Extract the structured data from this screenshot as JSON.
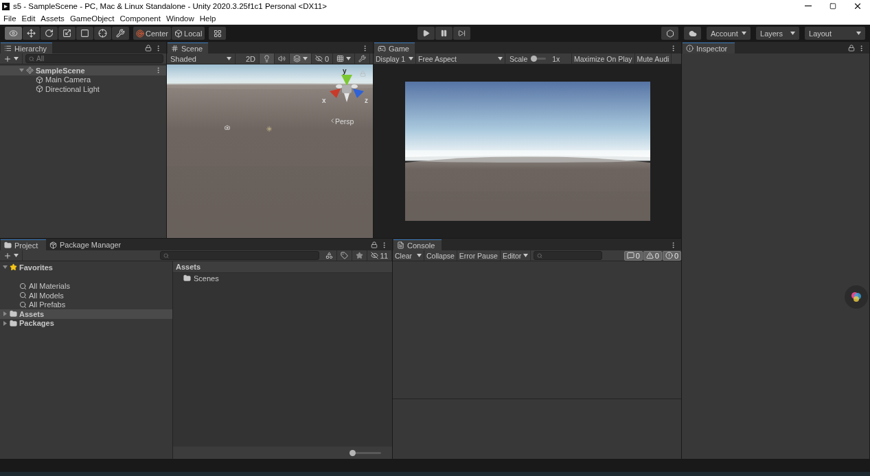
{
  "window": {
    "title": "s5 - SampleScene - PC, Mac & Linux Standalone - Unity 2020.3.25f1c1 Personal <DX11>"
  },
  "menu": [
    "File",
    "Edit",
    "Assets",
    "GameObject",
    "Component",
    "Window",
    "Help"
  ],
  "toolbar": {
    "tools": [
      {
        "selected": true
      },
      {
        "selected": false
      },
      {
        "selected": false
      },
      {
        "selected": false
      },
      {
        "selected": false
      },
      {
        "selected": false
      },
      {
        "selected": false
      }
    ],
    "pivot": [
      "Center",
      "Local"
    ],
    "dropdowns": [
      "Account",
      "Layers",
      "Layout"
    ]
  },
  "hierarchy": {
    "tab": "Hierarchy",
    "search_placeholder": "All",
    "tree": [
      {
        "label": "SampleScene",
        "kind": "scene",
        "expanded": true,
        "selected": true,
        "children": [
          {
            "label": "Main Camera",
            "kind": "object",
            "selected": false
          },
          {
            "label": "Directional Light",
            "kind": "object",
            "selected": false
          }
        ]
      }
    ]
  },
  "scene": {
    "tab": "Scene",
    "draw_mode": "Shaded",
    "mode_2d": "2D",
    "hidden_count": "0",
    "gizmo_labels": [
      "y",
      "x",
      "z"
    ],
    "projection": "Persp"
  },
  "game": {
    "tab": "Game",
    "display": "Display 1",
    "aspect": "Free Aspect",
    "scale_label": "Scale",
    "scale": {
      "level": 0
    },
    "scale_value": "1x",
    "buttons": [
      "Maximize On Play",
      "Mute Audi"
    ]
  },
  "inspector": {
    "tab": "Inspector"
  },
  "project": {
    "tabs": [
      {
        "label": "Project",
        "selected": true
      },
      {
        "label": "Package Manager",
        "selected": false
      }
    ],
    "hidden_count": "11",
    "tree": [
      {
        "label": "Favorites",
        "kind": "favorites",
        "expanded": true,
        "selected": false,
        "children": [
          {
            "label": "All Materials",
            "kind": "search",
            "selected": false
          },
          {
            "label": "All Models",
            "kind": "search",
            "selected": false
          },
          {
            "label": "All Prefabs",
            "kind": "search",
            "selected": false
          }
        ]
      },
      {
        "label": "Assets",
        "kind": "folder",
        "expanded": false,
        "selected": true
      },
      {
        "label": "Packages",
        "kind": "folder",
        "expanded": false,
        "selected": false
      }
    ],
    "breadcrumb": "Assets",
    "items": [
      "Scenes"
    ],
    "zoom": {
      "level": 0
    }
  },
  "console": {
    "tab": "Console",
    "buttons": [
      "Clear",
      "Collapse",
      "Error Pause",
      "Editor"
    ],
    "counts": [
      {
        "kind": "info",
        "count": "0"
      },
      {
        "kind": "warning",
        "count": "0"
      },
      {
        "kind": "error",
        "count": "0"
      }
    ]
  }
}
